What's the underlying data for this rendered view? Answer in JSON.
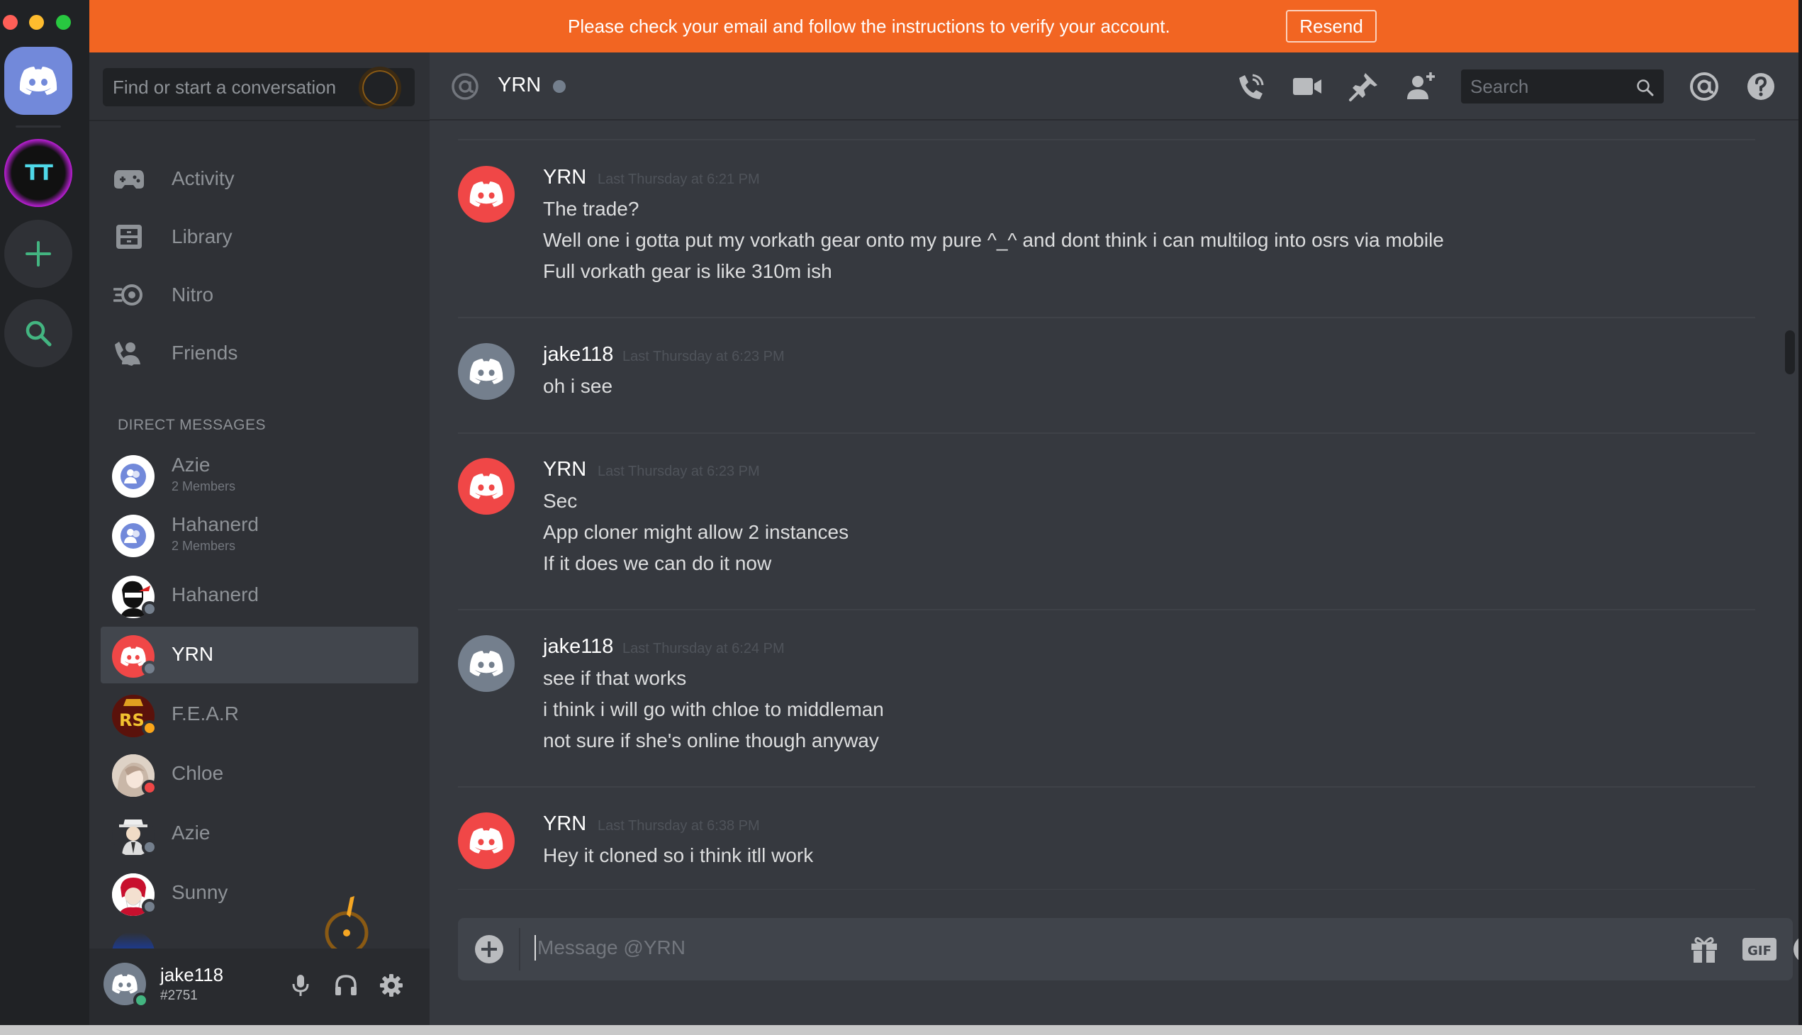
{
  "banner": {
    "message": "Please check your email and follow the instructions to verify your account.",
    "resend_label": "Resend",
    "color": "#f26522"
  },
  "servers": [
    {
      "name": "home",
      "icon": "discord-logo-icon"
    },
    {
      "name": "TT",
      "label": "TT"
    },
    {
      "name": "add-server",
      "icon": "plus-icon"
    },
    {
      "name": "explore",
      "icon": "search-icon"
    }
  ],
  "sidebar": {
    "search_placeholder": "Find or start a conversation",
    "nav": [
      {
        "label": "Activity",
        "icon": "gamepad-icon"
      },
      {
        "label": "Library",
        "icon": "library-icon"
      },
      {
        "label": "Nitro",
        "icon": "nitro-icon"
      },
      {
        "label": "Friends",
        "icon": "friends-icon"
      }
    ],
    "dm_header": "DIRECT MESSAGES",
    "dms": [
      {
        "name": "Azie",
        "sub": "2 Members",
        "type": "group"
      },
      {
        "name": "Hahanerd",
        "sub": "2 Members",
        "type": "group"
      },
      {
        "name": "Hahanerd",
        "status": "offline"
      },
      {
        "name": "YRN",
        "status": "offline",
        "active": true
      },
      {
        "name": "F.E.A.R",
        "status": "idle"
      },
      {
        "name": "Chloe",
        "status": "dnd"
      },
      {
        "name": "Azie",
        "status": "offline"
      },
      {
        "name": "Sunny",
        "status": "offline"
      }
    ]
  },
  "user": {
    "name": "jake118",
    "tag": "#2751",
    "status": "online"
  },
  "header": {
    "channel": "YRN",
    "search_placeholder": "Search",
    "icons": [
      "call-icon",
      "video-icon",
      "pin-icon",
      "add-friend-icon",
      "mention-icon",
      "help-icon"
    ]
  },
  "messages": [
    {
      "author": "YRN",
      "time": "Last Thursday at 6:21 PM",
      "avatar_color": "#f04747",
      "lines": [
        "The trade?",
        "Well one i gotta put my vorkath gear onto my pure ^_^ and dont think i can multilog into osrs via mobile",
        "Full vorkath gear is like 310m ish"
      ]
    },
    {
      "author": "jake118",
      "time": "Last Thursday at 6:23 PM",
      "avatar_color": "#747f8d",
      "lines": [
        "oh i see"
      ]
    },
    {
      "author": "YRN",
      "time": "Last Thursday at 6:23 PM",
      "avatar_color": "#f04747",
      "lines": [
        "Sec",
        "App cloner might allow 2 instances",
        "If it does we can do it now"
      ]
    },
    {
      "author": "jake118",
      "time": "Last Thursday at 6:24 PM",
      "avatar_color": "#747f8d",
      "lines": [
        "see if that works",
        "i think i will go with chloe to middleman",
        "not sure if she's online though anyway"
      ]
    },
    {
      "author": "YRN",
      "time": "Last Thursday at 6:38 PM",
      "avatar_color": "#f04747",
      "lines": [
        "Hey it cloned so i think itll work"
      ]
    }
  ],
  "composer": {
    "placeholder": "Message @YRN",
    "icons": [
      "gift-icon",
      "gif-icon",
      "emoji-icon"
    ]
  },
  "colors": {
    "accent": "#7289da",
    "online": "#43b581",
    "idle": "#faa61a",
    "dnd": "#f04747",
    "offline": "#747f8d"
  }
}
